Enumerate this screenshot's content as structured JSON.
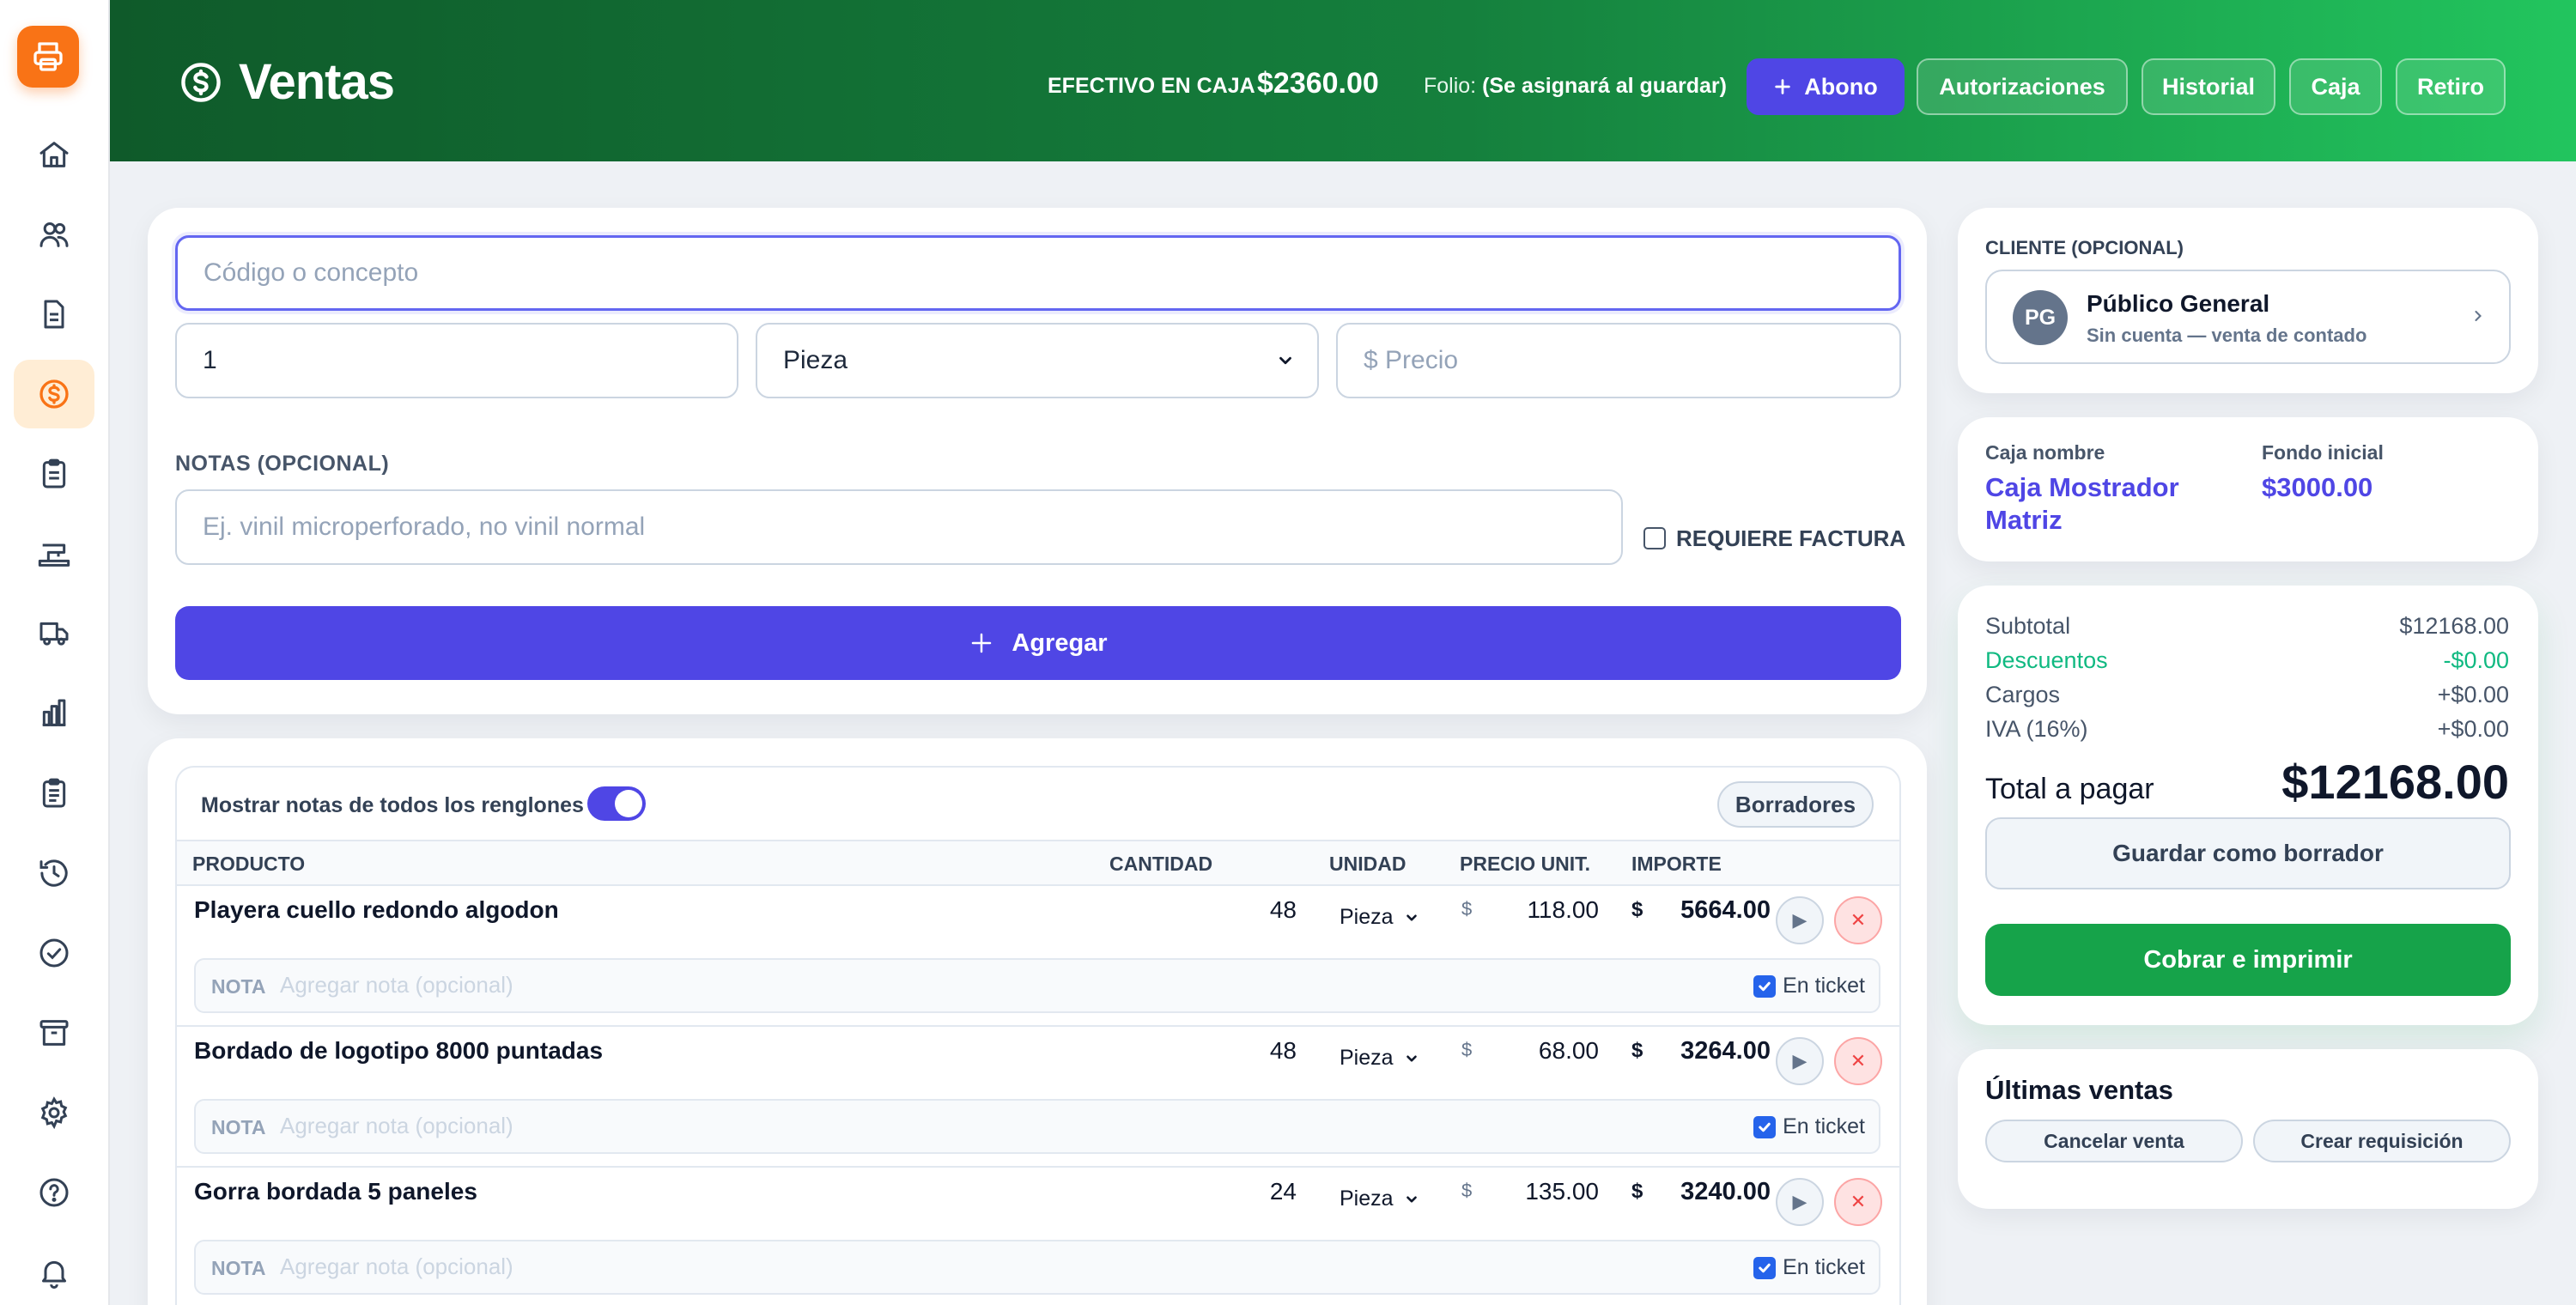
{
  "header": {
    "title": "Ventas",
    "cash_label": "EFECTIVO EN CAJA",
    "cash_value": "$2360.00",
    "folio_label": "Folio:",
    "folio_value": "(Se asignará al guardar)",
    "buttons": {
      "abono": "Abono",
      "autorizaciones": "Autorizaciones",
      "historial": "Historial",
      "caja": "Caja",
      "retiro": "Retiro"
    }
  },
  "sidebar": {
    "items": [
      "printer-icon",
      "home-icon",
      "users-icon",
      "document-icon",
      "dollar-icon",
      "clipboard-icon",
      "sewing-machine-icon",
      "truck-icon",
      "bar-chart-icon",
      "clipboard-list-icon",
      "history-icon",
      "check-circle-icon",
      "archive-icon",
      "gear-icon",
      "help-icon",
      "bell-icon"
    ],
    "active": "dollar-icon"
  },
  "entry": {
    "code_placeholder": "Código o concepto",
    "quantity": "1",
    "unit": "Pieza",
    "price_placeholder": "$ Precio",
    "notes_label": "NOTAS (OPCIONAL)",
    "notes_placeholder": "Ej. vinil microperforado, no vinil normal",
    "invoice_label": "REQUIERE FACTURA",
    "add_button": "Agregar"
  },
  "table": {
    "show_notes_label": "Mostrar notas de todos los renglones",
    "drafts_button": "Borradores",
    "columns": [
      "PRODUCTO",
      "CANTIDAD",
      "UNIDAD",
      "PRECIO UNIT.",
      "IMPORTE"
    ],
    "rows": [
      {
        "product": "Playera cuello redondo algodon",
        "qty": "48",
        "unit": "Pieza",
        "price": "118.00",
        "amount": "5664.00"
      },
      {
        "product": "Bordado de logotipo 8000 puntadas",
        "qty": "48",
        "unit": "Pieza",
        "price": "68.00",
        "amount": "3264.00"
      },
      {
        "product": "Gorra bordada 5 paneles",
        "qty": "24",
        "unit": "Pieza",
        "price": "135.00",
        "amount": "3240.00"
      }
    ],
    "currency_symbol": "$",
    "note_label": "NOTA",
    "note_placeholder": "Agregar nota (opcional)",
    "ticket_label": "En ticket"
  },
  "client": {
    "label": "CLIENTE (OPCIONAL)",
    "initials": "PG",
    "name": "Público General",
    "subtitle": "Sin cuenta — venta de contado"
  },
  "register": {
    "name_label": "Caja nombre",
    "name_line1": "Caja Mostrador",
    "name_line2": "Matriz",
    "fund_label": "Fondo inicial",
    "fund_value": "$3000.00"
  },
  "summary": {
    "subtotal_label": "Subtotal",
    "subtotal_value": "$12168.00",
    "discount_label": "Descuentos",
    "discount_value": "-$0.00",
    "charges_label": "Cargos",
    "charges_value": "+$0.00",
    "iva_label": "IVA (16%)",
    "iva_value": "+$0.00",
    "total_label": "Total a pagar",
    "total_value": "$12168.00",
    "save_draft": "Guardar como borrador",
    "charge_print": "Cobrar e imprimir"
  },
  "recent": {
    "title": "Últimas ventas",
    "cancel": "Cancelar venta",
    "requisition": "Crear requisición"
  },
  "colors": {
    "brand": "#15803d",
    "accent": "#4f46e5",
    "sidebar_active": "#f97316",
    "success": "#16a34a",
    "discount": "#10b981"
  }
}
